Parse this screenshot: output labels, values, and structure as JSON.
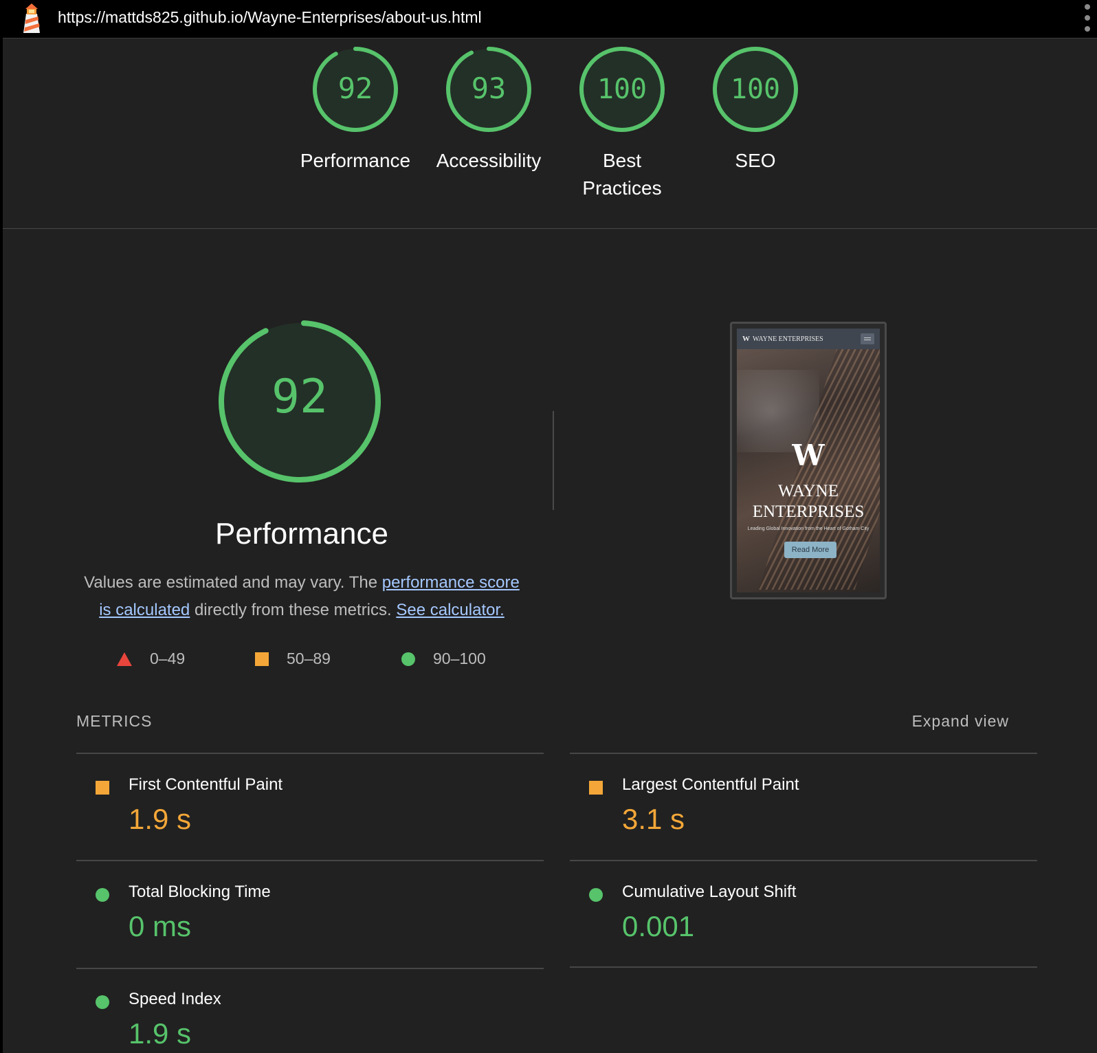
{
  "topbar": {
    "url": "https://mattds825.github.io/Wayne-Enterprises/about-us.html",
    "logo_icon": "lighthouse-icon",
    "menu_icon": "kebab-menu-icon"
  },
  "categories": [
    {
      "score": 92,
      "label": "Performance",
      "color": "#57c36b"
    },
    {
      "score": 93,
      "label": "Accessibility",
      "color": "#57c36b"
    },
    {
      "score": 100,
      "label": "Best Practices",
      "color": "#57c36b"
    },
    {
      "score": 100,
      "label": "SEO",
      "color": "#57c36b"
    }
  ],
  "performance": {
    "score": 92,
    "title": "Performance",
    "desc_prefix": "Values are estimated and may vary. The ",
    "link_score": "performance score is calculated",
    "desc_middle": " directly from these metrics. ",
    "link_calc": "See calculator."
  },
  "legend": [
    {
      "range": "0–49",
      "shape": "triangle",
      "color": "#e8453c"
    },
    {
      "range": "50–89",
      "shape": "square",
      "color": "#f4a738"
    },
    {
      "range": "90–100",
      "shape": "circle",
      "color": "#57c36b"
    }
  ],
  "thumbnail": {
    "nav_brand": "WAYNE ENTERPRISES",
    "logo_glyph": "W",
    "brand_line1": "WAYNE",
    "brand_line2": "ENTERPRISES",
    "tagline": "Leading Global Innovation from the Heart of Gotham City",
    "button": "Read More"
  },
  "metrics": {
    "heading": "METRICS",
    "expand_label": "Expand view",
    "items": [
      {
        "name": "First Contentful Paint",
        "value": "1.9 s",
        "rating": "average"
      },
      {
        "name": "Largest Contentful Paint",
        "value": "3.1 s",
        "rating": "average"
      },
      {
        "name": "Total Blocking Time",
        "value": "0 ms",
        "rating": "pass"
      },
      {
        "name": "Cumulative Layout Shift",
        "value": "0.001",
        "rating": "pass"
      },
      {
        "name": "Speed Index",
        "value": "1.9 s",
        "rating": "pass"
      }
    ]
  },
  "colors": {
    "pass": "#57c36b",
    "average": "#f4a738",
    "fail": "#e8453c",
    "background": "#212121",
    "link": "#a5c8ff"
  }
}
